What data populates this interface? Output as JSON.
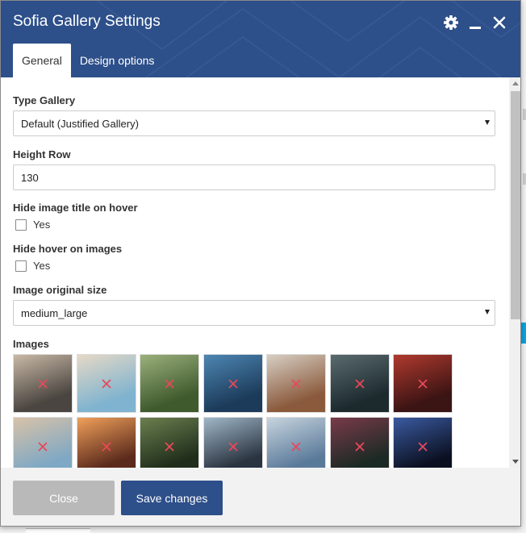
{
  "dialog": {
    "title": "Sofia Gallery Settings",
    "header_icons": [
      "gear-icon",
      "minimize-icon",
      "close-icon"
    ],
    "accent_color": "#2d4f8a"
  },
  "tabs": [
    {
      "label": "General",
      "active": true
    },
    {
      "label": "Design options",
      "active": false
    }
  ],
  "form": {
    "type_gallery": {
      "label": "Type Gallery",
      "value": "Default (Justified Gallery)"
    },
    "height_row": {
      "label": "Height Row",
      "value": "130"
    },
    "hide_title": {
      "label": "Hide image title on hover",
      "option": "Yes",
      "checked": false
    },
    "hide_hover": {
      "label": "Hide hover on images",
      "option": "Yes",
      "checked": false
    },
    "image_size": {
      "label": "Image original size",
      "value": "medium_large"
    },
    "images": {
      "label": "Images"
    }
  },
  "thumbnails": [
    {
      "c1": "#4a4540",
      "c2": "#c9b9a6"
    },
    {
      "c1": "#7fb3cf",
      "c2": "#e6d9c6"
    },
    {
      "c1": "#3f5a2d",
      "c2": "#9bb07c"
    },
    {
      "c1": "#1c3b5a",
      "c2": "#4d86b3"
    },
    {
      "c1": "#8b5a3c",
      "c2": "#d7cfc4"
    },
    {
      "c1": "#1c2a2e",
      "c2": "#5a6b6e"
    },
    {
      "c1": "#3b1414",
      "c2": "#b03a2e"
    },
    {
      "c1": "#7fa8c4",
      "c2": "#d8c2a8"
    },
    {
      "c1": "#5b2a1c",
      "c2": "#f0a05a"
    },
    {
      "c1": "#1f2d1a",
      "c2": "#6b7f4f"
    },
    {
      "c1": "#2a3340",
      "c2": "#9fb7c8"
    },
    {
      "c1": "#5a7a9a",
      "c2": "#c7d4de"
    },
    {
      "c1": "#1a2a24",
      "c2": "#7a3a4a"
    },
    {
      "c1": "#0b1020",
      "c2": "#3a5aa0"
    }
  ],
  "footer": {
    "close_label": "Close",
    "save_label": "Save changes"
  }
}
